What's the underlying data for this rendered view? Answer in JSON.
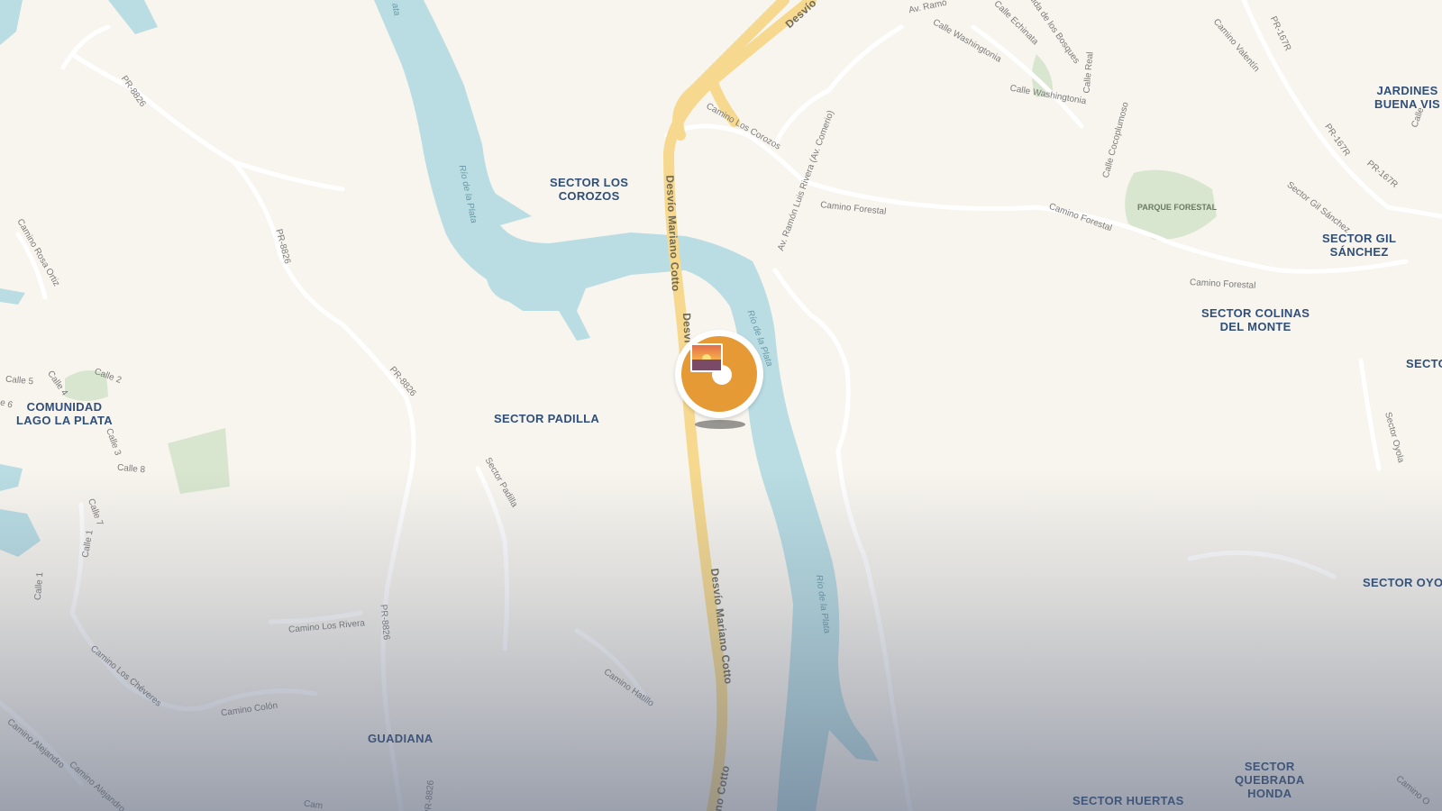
{
  "map": {
    "sectors": {
      "sector_los_corozos": "SECTOR LOS\nCOROZOS",
      "sector_padilla": "SECTOR PADILLA",
      "comunidad_lago_la_plata": "COMUNIDAD\nLAGO LA PLATA",
      "guadiana": "GUADIANA",
      "jardines_buena_vista": "JARDINES\nBUENA VIS",
      "sector_gil_sanchez": "SECTOR GIL\nSÁNCHEZ",
      "sector_colinas_del_monte": "SECTOR COLINAS\nDEL MONTE",
      "sector_edge_right": "SECTO",
      "sector_oyola": "SECTOR OYOL",
      "sector_quebrada_honda": "SECTOR\nQUEBRADA\nHONDA",
      "sector_huertas": "SECTOR HUERTAS"
    },
    "parks": {
      "parque_forestal": "PARQUE FORESTAL"
    },
    "highways": {
      "desvio_top": "Desvío",
      "desvio_mariano_cotto_1": "Desvío Mariano Cotto",
      "desvio_short": "Desvi",
      "desvio_mariano_cotto_2": "Desvío Mariano Cotto",
      "cotto_bottom": "no Cotto"
    },
    "rivers": {
      "rio_1": "Río de la Plata",
      "rio_2": "Río de la Plata",
      "rio_3": "Río de la Plata",
      "rio_top": "ata"
    },
    "roads": {
      "pr8826_a": "PR-8826",
      "pr8826_b": "PR-8826",
      "pr8826_c": "PR-8826",
      "pr8826_d": "PR-8826",
      "pr8826_e": "PR-8826",
      "camino_rosa_ortiz": "Camino Rosa Ortiz",
      "camino_los_corozos": "Camino Los Corozos",
      "av_ramon_luis_rivera": "Av. Ramón Luis Rivera (Av. Comerio)",
      "av_ramon_top": "Av. Ramó",
      "camino_forestal_1": "Camino Forestal",
      "camino_forestal_2": "Camino Forestal",
      "camino_forestal_3": "Camino Forestal",
      "calle_washingtonia_1": "Calle Washingtonia",
      "calle_washingtonia_2": "Calle Washingtonia",
      "calle_echinata": "Calle Echinata",
      "avenida_bosques": "enida de los Bosques",
      "calle_real": "Calle Real",
      "calle_cocoplumoso": "Calle Cocoplumoso",
      "camino_valentin": "Camino Valentín",
      "pr167r_1": "PR-167R",
      "pr167r_2": "PR-167R",
      "pr167r_3": "PR-167R",
      "calle_edge": "Calle",
      "sector_gil_sanchez_road": "Sector Gil Sánchez",
      "sector_padilla_road": "Sector Padilla",
      "camino_los_rivera": "Camino Los Rivera",
      "camino_los_cheveres": "Camino Los Chéveres",
      "camino_colon": "Camino Colón",
      "camino_hatillo": "Camino Hatillo",
      "camino_alejandro_1": "Camino Alejandro",
      "camino_alejandro_2": "Camino Alejandro",
      "camino_oyola": "Sector Oyola",
      "camino_bottom": "Cam",
      "camino_bottom_right": "Camino O",
      "calle_5": "Calle 5",
      "calle_4": "Calle 4",
      "calle_2": "Calle 2",
      "calle_6": "e 6",
      "calle_3": "Calle 3",
      "calle_8": "Calle 8",
      "calle_7": "Calle 7",
      "calle_1": "Calle 1",
      "calle_1b": "Calle 1"
    },
    "colors": {
      "land": "#f8f5ee",
      "water": "#b9dde3",
      "park": "#d8e6cf",
      "highway": "#f6d98e",
      "road": "#ffffff",
      "sector_label": "#2f4f7a",
      "pin": "#e59a35"
    },
    "marker": {
      "icon": "sunset-photo-icon"
    }
  }
}
